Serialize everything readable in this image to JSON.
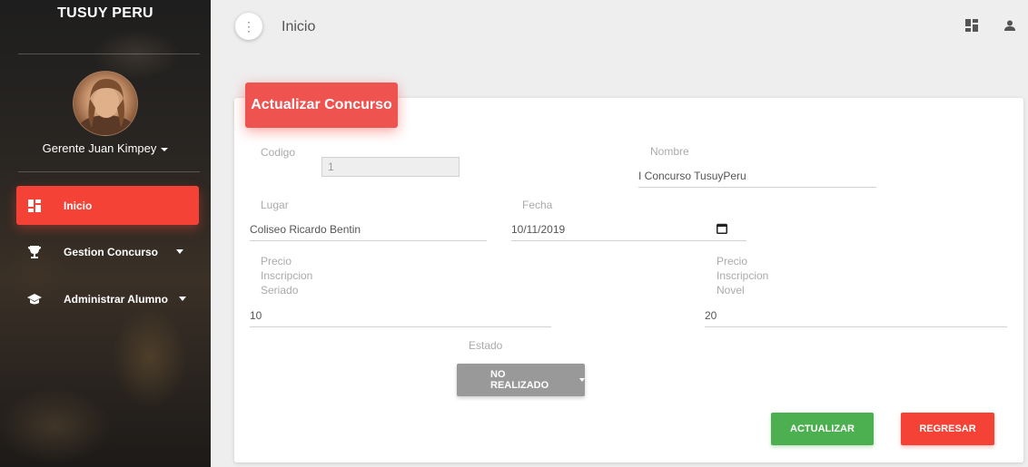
{
  "sidebar": {
    "brand": "TUSUY PERU",
    "user_name": "Gerente Juan Kimpey",
    "items": [
      {
        "label": "Inicio",
        "icon": "dashboard-icon",
        "active": true
      },
      {
        "label": "Gestion Concurso",
        "icon": "trophy-icon"
      },
      {
        "label": "Administrar Alumno",
        "icon": "graduation-cap-icon"
      }
    ]
  },
  "header": {
    "title": "Inicio",
    "icons": [
      "dashboard-icon",
      "person-icon"
    ]
  },
  "form": {
    "title": "Actualizar Concurso",
    "codigo_label": "Codigo",
    "codigo_value": "1",
    "nombre_label": "Nombre",
    "nombre_value": "I Concurso TusuyPeru",
    "lugar_label": "Lugar",
    "lugar_value": "Coliseo Ricardo Bentin",
    "fecha_label": "Fecha",
    "fecha_value": "10/11/2019",
    "precio_seriado_label": [
      "Precio",
      "Inscripcion",
      "Seriado"
    ],
    "precio_seriado_value": "10",
    "precio_novel_label": [
      "Precio",
      "Inscripcion",
      "Novel"
    ],
    "precio_novel_value": "20",
    "estado_label": "Estado",
    "estado_value": "NO REALIZADO",
    "actualizar_label": "ACTUALIZAR",
    "regresar_label": "REGRESAR"
  },
  "colors": {
    "accent_red": "#f44336",
    "green": "#4caf50",
    "select_gray": "#999999"
  }
}
